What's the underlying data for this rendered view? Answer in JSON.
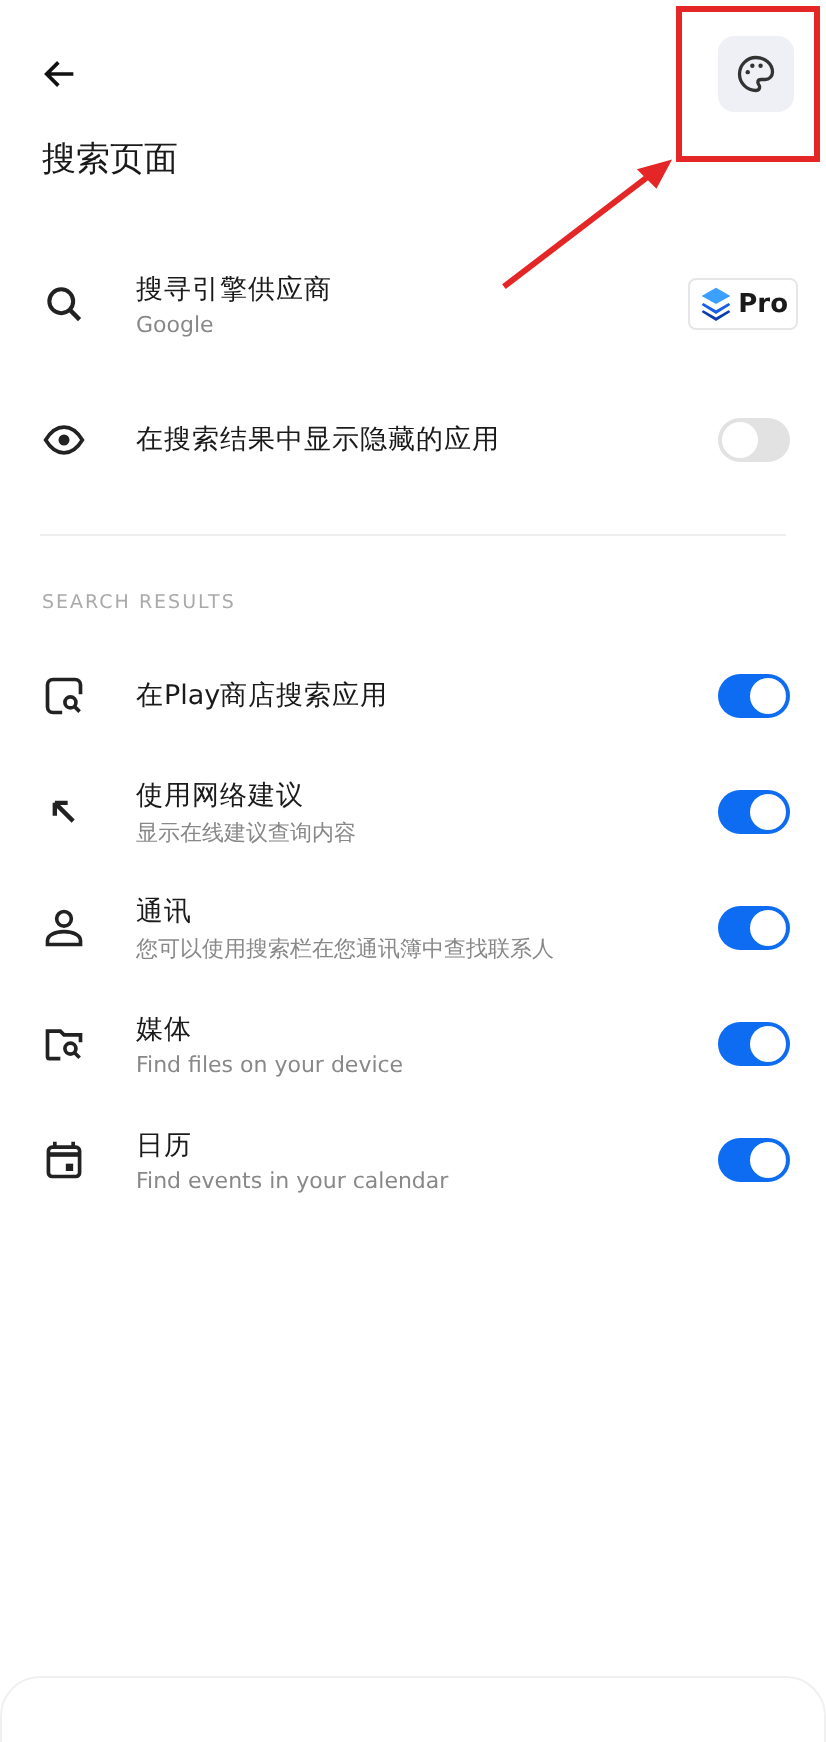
{
  "header": {
    "title": "搜索页面"
  },
  "general": [
    {
      "kind": "badge",
      "title": "搜寻引擎供应商",
      "subtitle": "Google",
      "badge": "Pro"
    },
    {
      "kind": "toggle",
      "title": "在搜索结果中显示隐藏的应用",
      "on": false
    }
  ],
  "section": {
    "label": "SEARCH RESULTS",
    "rows": [
      {
        "kind": "toggle",
        "title": "在Play商店搜索应用",
        "on": true
      },
      {
        "kind": "toggle",
        "title": "使用网络建议",
        "subtitle": "显示在线建议查询内容",
        "on": true
      },
      {
        "kind": "toggle",
        "title": "通讯",
        "subtitle": "您可以使用搜索栏在您通讯簿中查找联系人",
        "on": true
      },
      {
        "kind": "toggle",
        "title": "媒体",
        "subtitle": "Find files on your device",
        "on": true
      },
      {
        "kind": "toggle",
        "title": "日历",
        "subtitle": "Find events in your calendar",
        "on": true
      }
    ]
  }
}
